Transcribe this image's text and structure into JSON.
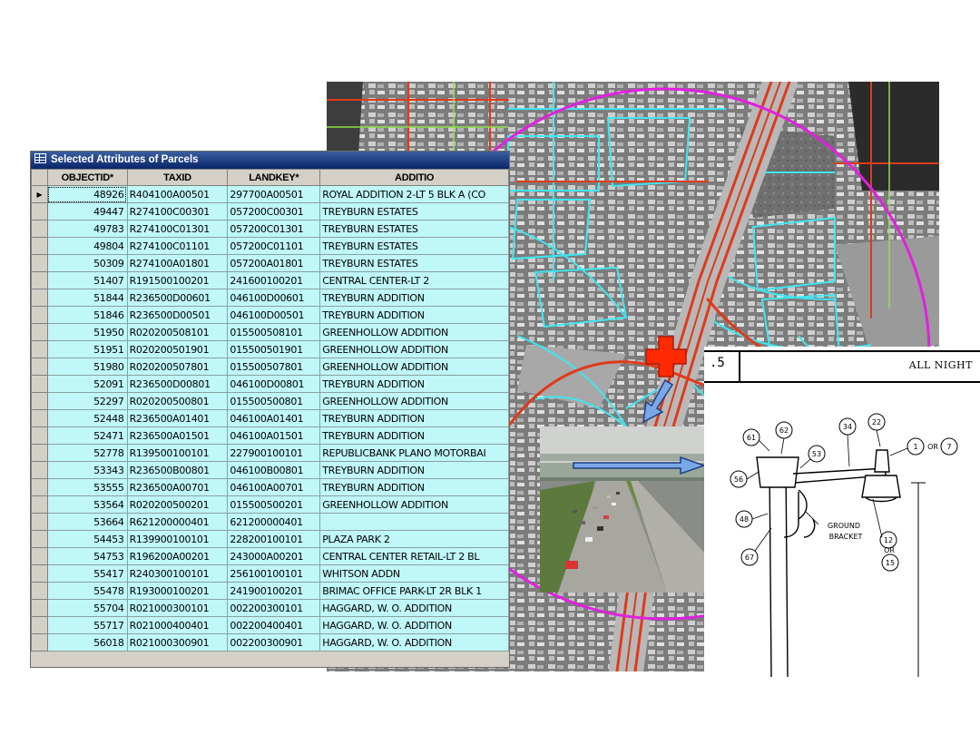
{
  "table_window": {
    "title": "Selected Attributes of Parcels",
    "columns": [
      "OBJECTID*",
      "TAXID",
      "LANDKEY*",
      "ADDITIO"
    ],
    "rows": [
      [
        "48926",
        "R404100A00501",
        "297700A00501",
        "ROYAL ADDITION 2-LT 5 BLK A (CO"
      ],
      [
        "49447",
        "R274100C00301",
        "057200C00301",
        "TREYBURN ESTATES"
      ],
      [
        "49783",
        "R274100C01301",
        "057200C01301",
        "TREYBURN ESTATES"
      ],
      [
        "49804",
        "R274100C01101",
        "057200C01101",
        "TREYBURN ESTATES"
      ],
      [
        "50309",
        "R274100A01801",
        "057200A01801",
        "TREYBURN ESTATES"
      ],
      [
        "51407",
        "R191500100201",
        "241600100201",
        "CENTRAL CENTER-LT 2"
      ],
      [
        "51844",
        "R236500D00601",
        "046100D00601",
        "TREYBURN ADDITION"
      ],
      [
        "51846",
        "R236500D00501",
        "046100D00501",
        "TREYBURN ADDITION"
      ],
      [
        "51950",
        "R020200508101",
        "015500508101",
        "GREENHOLLOW ADDITION"
      ],
      [
        "51951",
        "R020200501901",
        "015500501901",
        "GREENHOLLOW ADDITION"
      ],
      [
        "51980",
        "R020200507801",
        "015500507801",
        "GREENHOLLOW ADDITION"
      ],
      [
        "52091",
        "R236500D00801",
        "046100D00801",
        "TREYBURN ADDITION"
      ],
      [
        "52297",
        "R020200500801",
        "015500500801",
        "GREENHOLLOW ADDITION"
      ],
      [
        "52448",
        "R236500A01401",
        "046100A01401",
        "TREYBURN ADDITION"
      ],
      [
        "52471",
        "R236500A01501",
        "046100A01501",
        "TREYBURN ADDITION"
      ],
      [
        "52778",
        "R139500100101",
        "227900100101",
        "REPUBLICBANK PLANO MOTORBAI"
      ],
      [
        "53343",
        "R236500B00801",
        "046100B00801",
        "TREYBURN ADDITION"
      ],
      [
        "53555",
        "R236500A00701",
        "046100A00701",
        "TREYBURN ADDITION"
      ],
      [
        "53564",
        "R020200500201",
        "015500500201",
        "GREENHOLLOW ADDITION"
      ],
      [
        "53664",
        "R621200000401",
        "621200000401",
        ""
      ],
      [
        "54453",
        "R139900100101",
        "228200100101",
        "PLAZA PARK 2"
      ],
      [
        "54753",
        "R196200A00201",
        "243000A00201",
        "CENTRAL CENTER RETAIL-LT 2 BL"
      ],
      [
        "55417",
        "R240300100101",
        "256100100101",
        "WHITSON ADDN"
      ],
      [
        "55478",
        "R193000100201",
        "241900100201",
        "BRIMAC OFFICE PARK-LT 2R BLK 1"
      ],
      [
        "55704",
        "R021000300101",
        "002200300101",
        "HAGGARD, W. O. ADDITION"
      ],
      [
        "55717",
        "R021000400401",
        "002200400401",
        "HAGGARD, W. O. ADDITION"
      ],
      [
        "56018",
        "R021000300901",
        "002200300901",
        "HAGGARD, W. O. ADDITION"
      ]
    ],
    "current_row_marker": "▶"
  },
  "drawing": {
    "header_number": ".5",
    "header_text": "ALL NIGHT",
    "callouts": [
      "61",
      "62",
      "34",
      "22",
      "1",
      "OR",
      "7",
      "56",
      "53",
      "48",
      "67",
      "12",
      "OR",
      "15",
      "GROUND",
      "BRACKET"
    ]
  },
  "colors": {
    "table_cell": "#c0f7f9",
    "parcel_lines": "#3fe6f0",
    "roads": "#e03a1a",
    "buffer_circle": "#e020e0",
    "marker": "#ff2a00",
    "arrow": "#7aa7e8"
  }
}
